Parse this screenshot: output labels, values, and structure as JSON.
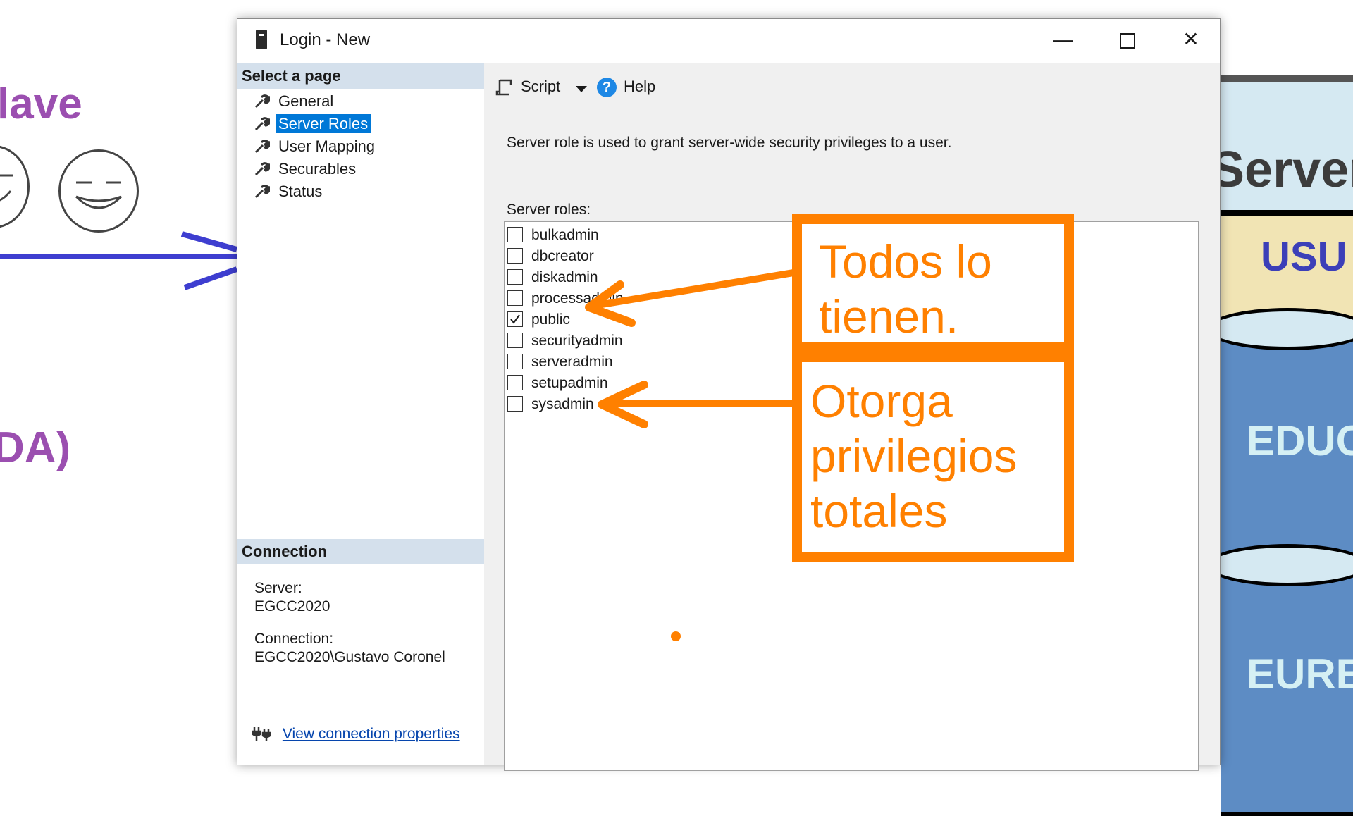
{
  "background": {
    "left_title": "lave",
    "left_title2": "DA)",
    "right_title": "Server",
    "right_label": "USU",
    "db1_label": "EDUC",
    "db2_label": "EURE"
  },
  "window": {
    "title": "Login - New",
    "minimize": "—",
    "close": "✕"
  },
  "left_pane": {
    "select_header": "Select a page",
    "pages": [
      {
        "label": "General",
        "selected": false
      },
      {
        "label": "Server Roles",
        "selected": true
      },
      {
        "label": "User Mapping",
        "selected": false
      },
      {
        "label": "Securables",
        "selected": false
      },
      {
        "label": "Status",
        "selected": false
      }
    ],
    "connection_header": "Connection",
    "server_label": "Server:",
    "server_value": "EGCC2020",
    "connection_label": "Connection:",
    "connection_value": "EGCC2020\\Gustavo Coronel",
    "view_link": "View connection properties"
  },
  "toolbar": {
    "script_label": "Script",
    "help_label": "Help",
    "help_glyph": "?"
  },
  "main": {
    "description": "Server role is used to grant server-wide security privileges to a user.",
    "roles_label": "Server roles:",
    "roles": [
      {
        "name": "bulkadmin",
        "checked": false
      },
      {
        "name": "dbcreator",
        "checked": false
      },
      {
        "name": "diskadmin",
        "checked": false
      },
      {
        "name": "processadmin",
        "checked": false
      },
      {
        "name": "public",
        "checked": true
      },
      {
        "name": "securityadmin",
        "checked": false
      },
      {
        "name": "serveradmin",
        "checked": false
      },
      {
        "name": "setupadmin",
        "checked": false
      },
      {
        "name": "sysadmin",
        "checked": false
      }
    ]
  },
  "annotations": {
    "box1_line1": "Todos lo",
    "box1_line2": "tienen.",
    "box2_line1": "Otorga",
    "box2_line2": "privilegios",
    "box2_line3": "totales",
    "color": "#ff8000"
  }
}
